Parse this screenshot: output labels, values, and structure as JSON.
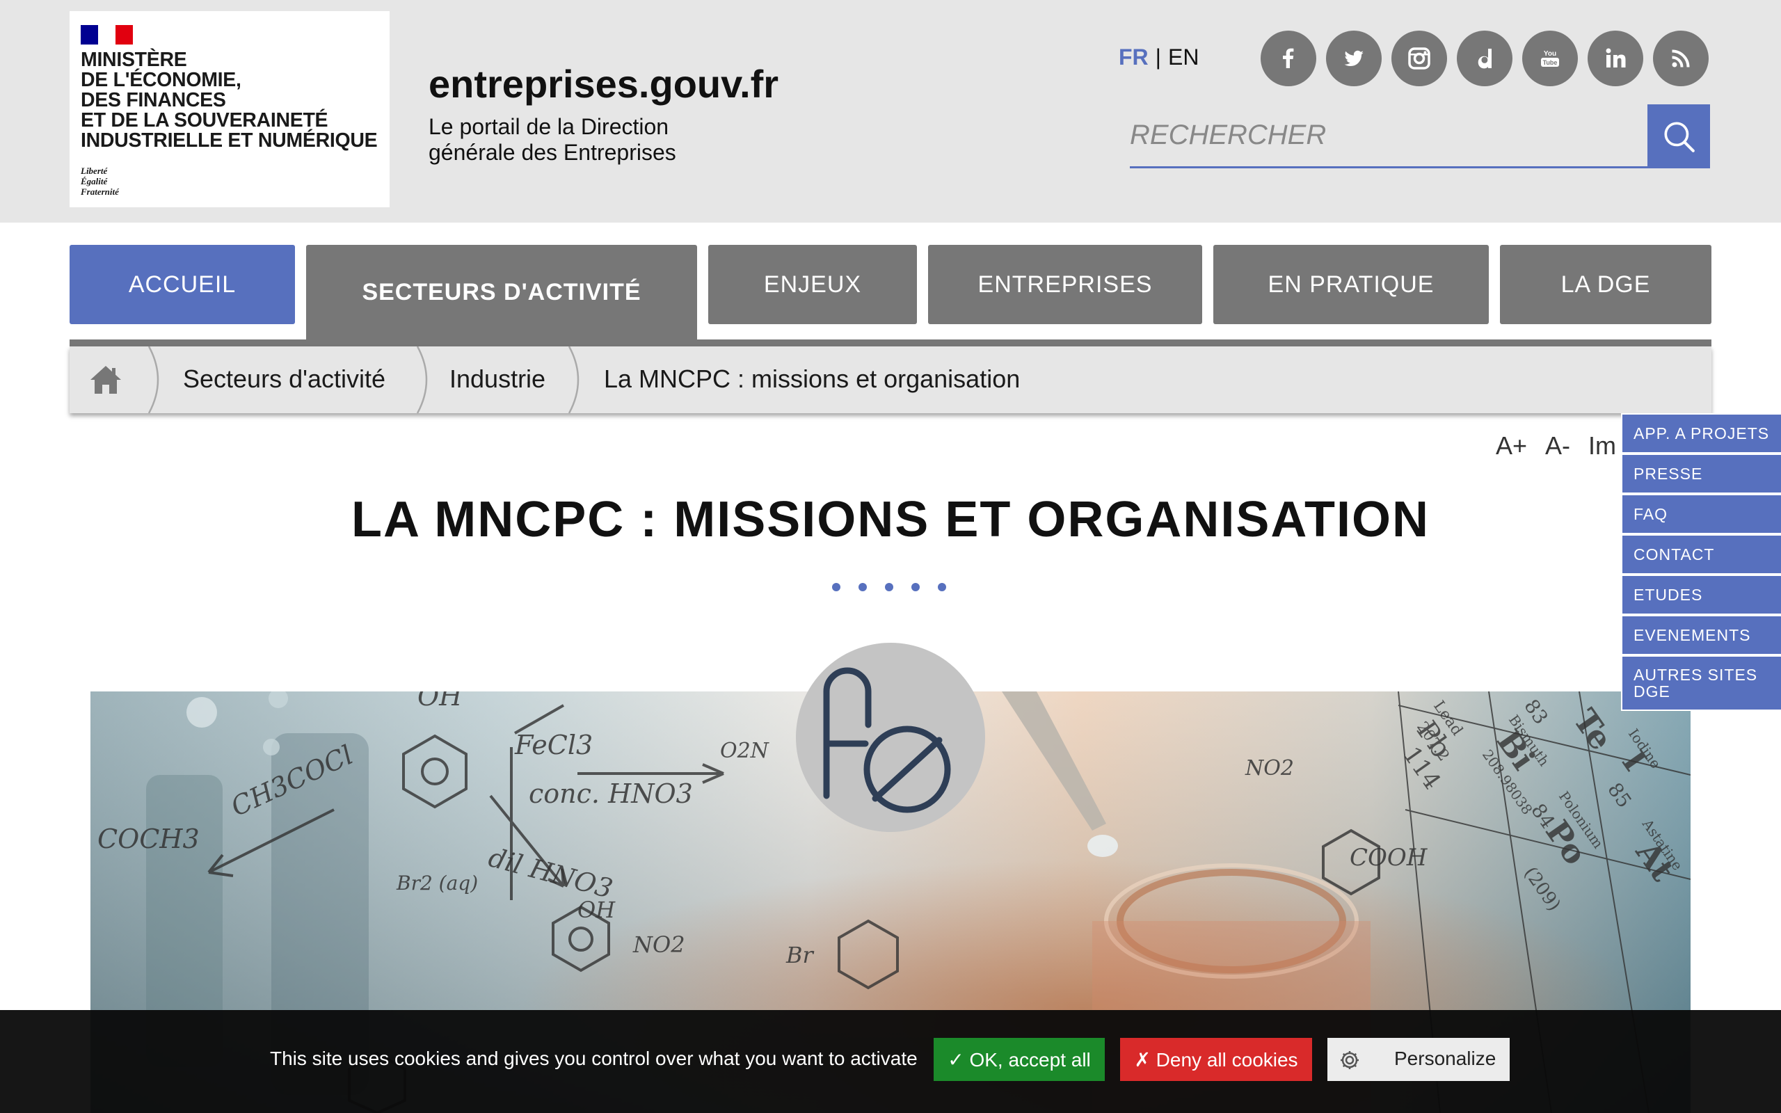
{
  "header": {
    "logo": {
      "ministry_lines": [
        "MINISTÈRE",
        "DE L'ÉCONOMIE,",
        "DES FINANCES",
        "ET DE LA SOUVERAINETÉ",
        "INDUSTRIELLE ET NUMÉRIQUE"
      ],
      "devise_lines": [
        "Liberté",
        "Égalité",
        "Fraternité"
      ]
    },
    "site_name": "entreprises.gouv.fr",
    "tagline": "Le portail de la Direction générale des Entreprises",
    "lang": {
      "fr": "FR",
      "separator": "|",
      "en": "EN"
    },
    "socials": [
      "facebook-icon",
      "twitter-icon",
      "instagram-icon",
      "dailymotion-icon",
      "youtube-icon",
      "linkedin-icon",
      "rss-icon"
    ],
    "search": {
      "placeholder": "RECHERCHER",
      "value": ""
    }
  },
  "nav": {
    "items": [
      {
        "label": "ACCUEIL"
      },
      {
        "label": "SECTEURS D'ACTIVITÉ"
      },
      {
        "label": "ENJEUX"
      },
      {
        "label": "ENTREPRISES"
      },
      {
        "label": "EN PRATIQUE"
      },
      {
        "label": "LA DGE"
      }
    ]
  },
  "breadcrumb": {
    "items": [
      "Secteurs d'activité",
      "Industrie",
      "La MNCPC : missions et organisation"
    ]
  },
  "tools": {
    "increase": "A+",
    "decrease": "A-",
    "print": "Im"
  },
  "sidemenu": {
    "items": [
      "APP. A PROJETS",
      "PRESSE",
      "FAQ",
      "CONTACT",
      "ETUDES",
      "EVENEMENTS",
      "AUTRES SITES DGE"
    ]
  },
  "page": {
    "title": "LA MNCPC : MISSIONS ET ORGANISATION"
  },
  "hero": {
    "chem_labels": [
      "OH",
      "FeCl3",
      "conc. HNO3",
      "CH3COCl",
      "COCH3",
      "dil HNO3",
      "Br2 (aq)",
      "OH",
      "NO2",
      "Br",
      "COOH",
      "O2N",
      "NO2",
      "Pb",
      "Lead",
      "207.2",
      "114",
      "Bi",
      "Bismuth",
      "208.98038",
      "83",
      "Te",
      "Po",
      "Polonium",
      "(209)",
      "84",
      "I",
      "Iodine",
      "At",
      "Astatine",
      "85"
    ]
  },
  "cookie": {
    "text": "This site uses cookies and gives you control over what you want to activate",
    "ok": "✓ OK, accept all",
    "deny": "✗ Deny all cookies",
    "personalize": "Personalize"
  },
  "colors": {
    "header_bg": "#e6e6e6",
    "accent": "#5770be",
    "nav_grey": "#777777",
    "ok_green": "#1b8a2a",
    "deny_red": "#d92a2a"
  }
}
